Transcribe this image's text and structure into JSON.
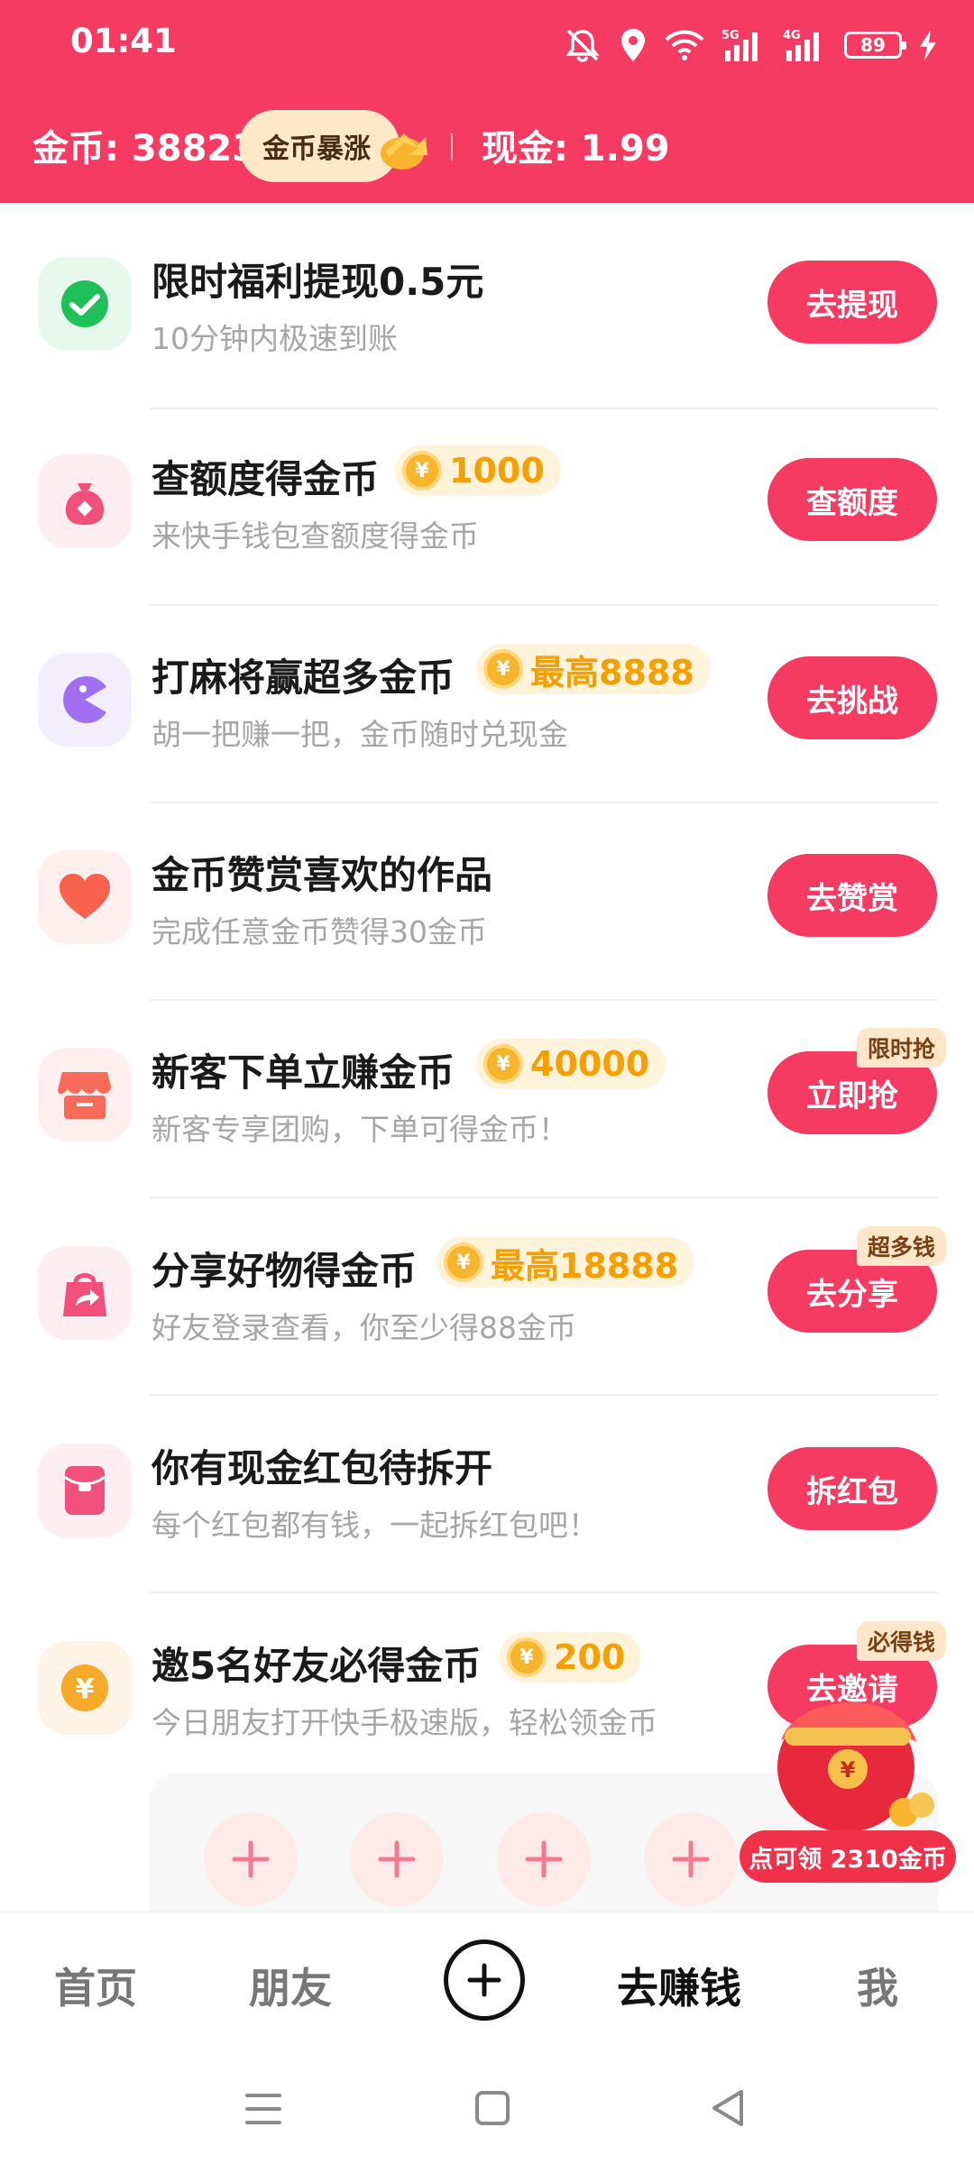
{
  "status_bar": {
    "time": "01:41",
    "battery": "89",
    "icons": [
      "mute-icon",
      "location-icon",
      "wifi-icon",
      "5g-signal-icon",
      "4g-signal-icon",
      "battery-icon",
      "charging-icon"
    ]
  },
  "header": {
    "coins": "金币: 38823",
    "surge_label": "金币暴涨",
    "cash": "现金: 1.99"
  },
  "tasks": [
    {
      "title": "限时福利提现0.5元",
      "subtitle": "10分钟内极速到账",
      "reward": "",
      "button": "去提现",
      "badge": "",
      "icon": "wechat-check-icon"
    },
    {
      "title": "查额度得金币",
      "subtitle": "来快手钱包查额度得金币",
      "reward": "1000",
      "button": "查额度",
      "badge": "",
      "icon": "money-bag-icon"
    },
    {
      "title": "打麻将赢超多金币",
      "subtitle": "胡一把赚一把，金币随时兑现金",
      "reward": "最高8888",
      "button": "去挑战",
      "badge": "",
      "icon": "game-pacman-icon"
    },
    {
      "title": "金币赞赏喜欢的作品",
      "subtitle": "完成任意金币赞得30金币",
      "reward": "",
      "button": "去赞赏",
      "badge": "",
      "icon": "heart-icon"
    },
    {
      "title": "新客下单立赚金币",
      "subtitle": "新客专享团购，下单可得金币！",
      "reward": "40000",
      "button": "立即抢",
      "badge": "限时抢",
      "icon": "shop-icon"
    },
    {
      "title": "分享好物得金币",
      "subtitle": "好友登录查看，你至少得88金币",
      "reward": "最高18888",
      "button": "去分享",
      "badge": "超多钱",
      "icon": "share-bag-icon"
    },
    {
      "title": "你有现金红包待拆开",
      "subtitle": "每个红包都有钱，一起拆红包吧！",
      "reward": "",
      "button": "拆红包",
      "badge": "",
      "icon": "red-packet-icon"
    },
    {
      "title": "邀5名好友必得金币",
      "subtitle": "今日朋友打开快手极速版，轻松领金币",
      "reward": "200",
      "button": "去邀请",
      "badge": "必得钱",
      "icon": "yuan-coin-icon"
    }
  ],
  "floating_reward": {
    "label": "点可领 2310金币"
  },
  "bottom_nav": {
    "home": "首页",
    "friends": "朋友",
    "earn": "去赚钱",
    "me": "我"
  },
  "colors": {
    "brand": "#f53b62",
    "reward_text": "#f5a000",
    "reward_bg": "#fff3dc"
  }
}
